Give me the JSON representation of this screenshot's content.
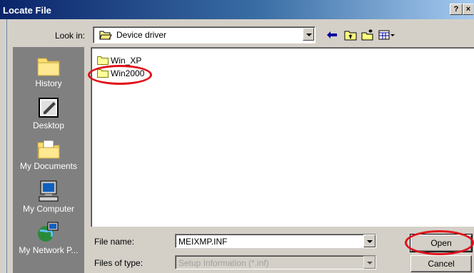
{
  "window": {
    "title": "Locate File",
    "help_glyph": "?",
    "close_glyph": "×"
  },
  "lookin": {
    "label": "Look in:",
    "value": "Device driver"
  },
  "toolbar": [
    "back-icon",
    "up-folder-icon",
    "new-folder-icon",
    "view-menu-icon"
  ],
  "places": [
    {
      "label": "History",
      "icon": "history-icon"
    },
    {
      "label": "Desktop",
      "icon": "desktop-icon"
    },
    {
      "label": "My Documents",
      "icon": "my-documents-icon"
    },
    {
      "label": "My Computer",
      "icon": "my-computer-icon"
    },
    {
      "label": "My Network P...",
      "icon": "network-places-icon"
    }
  ],
  "files": [
    {
      "name": "Win_XP",
      "icon": "folder-icon"
    },
    {
      "name": "Win2000",
      "icon": "folder-icon"
    }
  ],
  "filename": {
    "label": "File name:",
    "value": "MEIXMP.INF"
  },
  "filetype": {
    "label": "Files of type:",
    "value": "Setup Information (*.inf)"
  },
  "buttons": {
    "open": "Open",
    "cancel": "Cancel"
  },
  "colors": {
    "highlight_ellipse": "#e0101a",
    "titlebar": "#0a246a",
    "places_bg": "#808080"
  }
}
